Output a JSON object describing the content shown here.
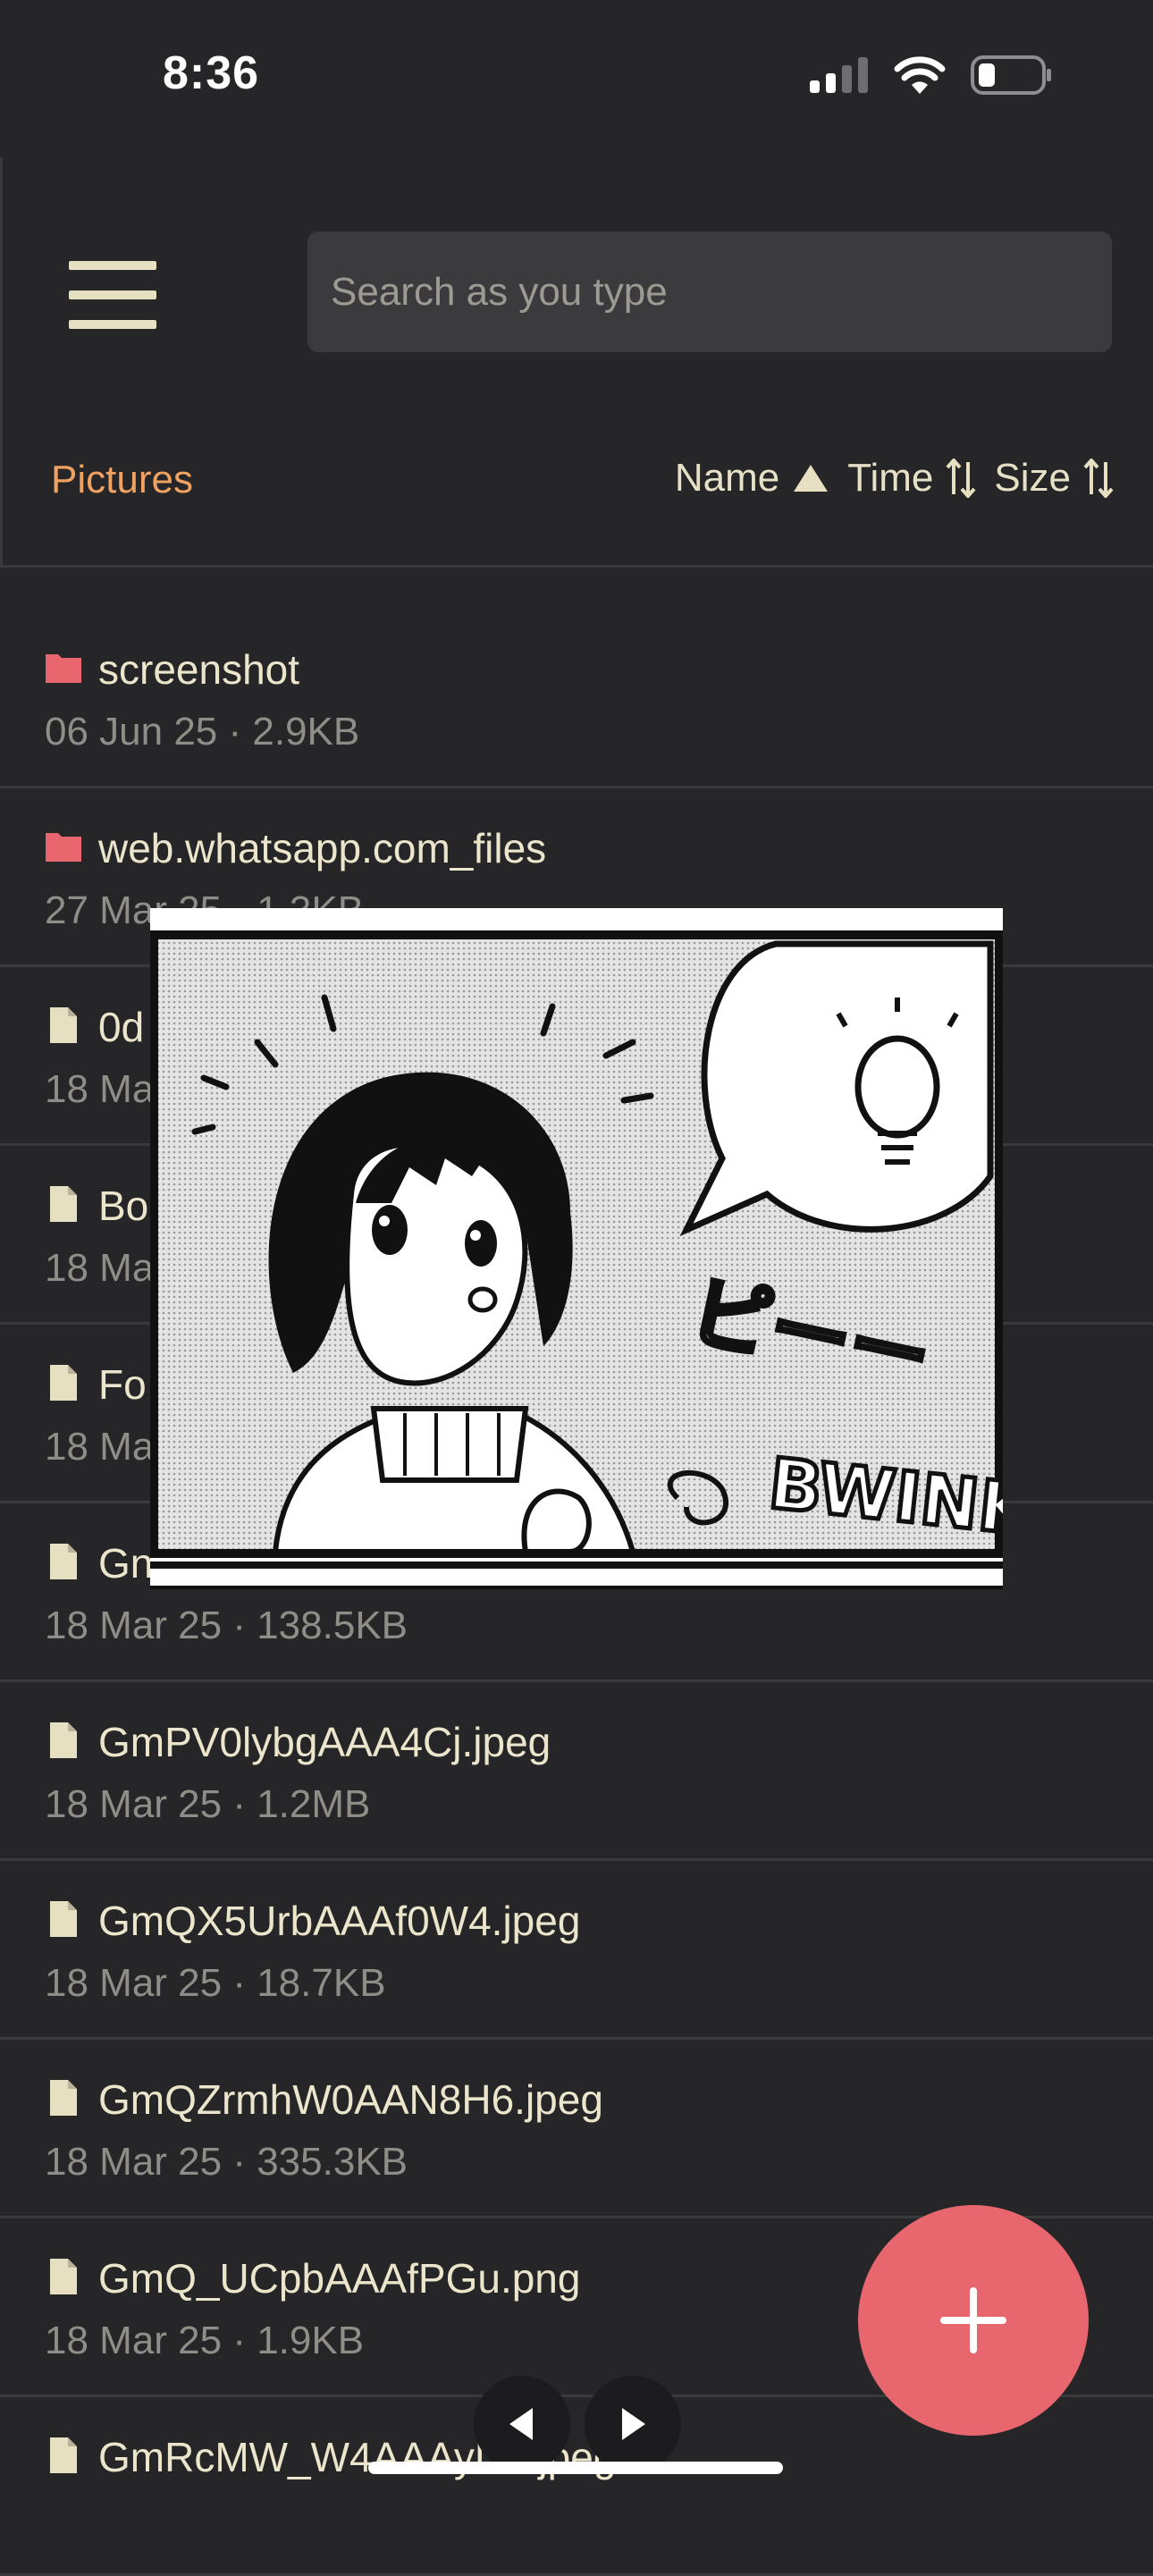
{
  "status_bar": {
    "time": "8:36"
  },
  "header": {
    "search_placeholder": "Search as you type",
    "breadcrumb": "Pictures",
    "sort": {
      "name_label": "Name",
      "time_label": "Time",
      "size_label": "Size",
      "active": "Name",
      "direction": "ascending"
    }
  },
  "files": [
    {
      "type": "folder",
      "name": "screenshot",
      "meta": "06 Jun 25 · 2.9KB"
    },
    {
      "type": "folder",
      "name": "web.whatsapp.com_files",
      "meta": "27 Mar 25 · 1.3KB"
    },
    {
      "type": "file",
      "name": "0d",
      "meta": "18 Ma"
    },
    {
      "type": "file",
      "name": "Bo",
      "meta": "18 Ma"
    },
    {
      "type": "file",
      "name": "Fo",
      "meta": "18 Ma"
    },
    {
      "type": "file",
      "name": "Gn",
      "meta": "18 Mar 25 · 138.5KB"
    },
    {
      "type": "file",
      "name": "GmPV0lybgAAA4Cj.jpeg",
      "meta": "18 Mar 25 · 1.2MB"
    },
    {
      "type": "file",
      "name": "GmQX5UrbAAAf0W4.jpeg",
      "meta": "18 Mar 25 · 18.7KB"
    },
    {
      "type": "file",
      "name": "GmQZrmhW0AAN8H6.jpeg",
      "meta": "18 Mar 25 · 335.3KB"
    },
    {
      "type": "file",
      "name": "GmQ_UCpbAAAfPGu.png",
      "meta": "18 Mar 25 · 1.9KB"
    },
    {
      "type": "file",
      "name": "GmRcMW_W4AAAyDh.jpeg",
      "meta": ""
    }
  ],
  "preview": {
    "sfx_katakana": "ピーー",
    "sfx_english": "BWINK"
  },
  "fab": {
    "icon": "plus-icon",
    "color": "#e8666e"
  },
  "colors": {
    "background": "#262628",
    "accent": "#f0a262",
    "folder": "#e8666e",
    "text": "#ebe5cc"
  }
}
